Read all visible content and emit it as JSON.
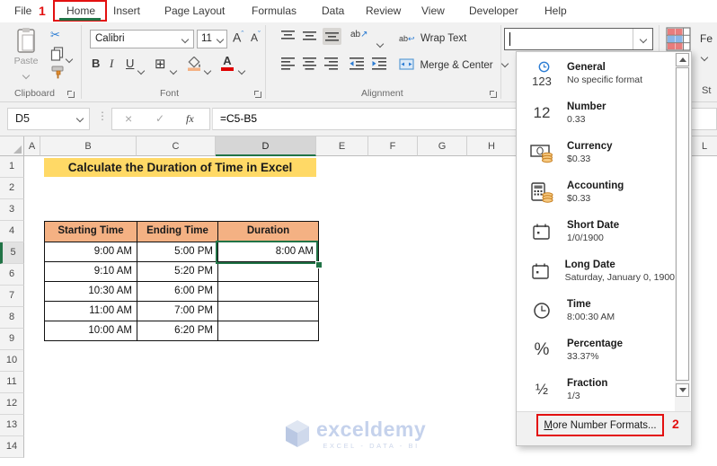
{
  "annotations": {
    "step1": "1",
    "step2": "2"
  },
  "tabs": {
    "items": [
      "File",
      "Home",
      "Insert",
      "Page Layout",
      "Formulas",
      "Data",
      "Review",
      "View",
      "Developer",
      "Help"
    ],
    "active": "Home"
  },
  "ribbon": {
    "clipboard": {
      "group_label": "Clipboard",
      "paste_label": "Paste"
    },
    "font": {
      "group_label": "Font",
      "font_name": "Calibri",
      "font_size": "11",
      "bold": "B",
      "italic": "I",
      "underline": "U",
      "grow": "A",
      "shrink": "A",
      "color_letter": "A"
    },
    "alignment": {
      "group_label": "Alignment",
      "wrap_text": "Wrap Text",
      "merge_center": "Merge & Center",
      "orientation_glyph": "ab"
    },
    "styles_fragment": {
      "fe": "Fe",
      "st": "St"
    }
  },
  "formula_bar": {
    "name_box": "D5",
    "cancel_glyph": "×",
    "enter_glyph": "✓",
    "fx_label": "fx",
    "formula": "=C5-B5"
  },
  "sheet": {
    "columns": [
      "A",
      "B",
      "C",
      "D",
      "E",
      "F",
      "G",
      "H"
    ],
    "partial_column": "L",
    "rows": [
      "1",
      "2",
      "3",
      "4",
      "5",
      "6",
      "7",
      "8",
      "9",
      "10",
      "11",
      "12",
      "13",
      "14"
    ],
    "selected_cell": "D5",
    "title": "Calculate the Duration of Time in Excel",
    "table": {
      "headers": [
        "Starting Time",
        "Ending Time",
        "Duration"
      ],
      "rows": [
        [
          "9:00 AM",
          "5:00 PM",
          "8:00 AM"
        ],
        [
          "9:10 AM",
          "5:20 PM",
          ""
        ],
        [
          "10:30 AM",
          "6:00 PM",
          ""
        ],
        [
          "11:00 AM",
          "7:00 PM",
          ""
        ],
        [
          "10:00 AM",
          "6:20 PM",
          ""
        ]
      ]
    },
    "watermark": {
      "brand": "exceldemy",
      "tagline": "EXCEL - DATA - BI"
    }
  },
  "format_dropdown": {
    "items": [
      {
        "name": "General",
        "example": "No specific format",
        "glyph": "123"
      },
      {
        "name": "Number",
        "example": "0.33",
        "glyph": "12"
      },
      {
        "name": "Currency",
        "example": "$0.33"
      },
      {
        "name": "Accounting",
        "example": "$0.33"
      },
      {
        "name": "Short Date",
        "example": "1/0/1900"
      },
      {
        "name": "Long Date",
        "example": "Saturday, January 0, 1900"
      },
      {
        "name": "Time",
        "example": "8:00:30 AM"
      },
      {
        "name": "Percentage",
        "example": "33.37%",
        "glyph": "%"
      },
      {
        "name": "Fraction",
        "example": "1/3",
        "glyph": "½"
      }
    ],
    "footer": "More Number Formats..."
  },
  "colors": {
    "excel_green": "#217346",
    "annotation_red": "#e31010",
    "title_bg": "#FFD966",
    "table_header_bg": "#F4B183",
    "coin_orange": "#E8A33D",
    "icon_blue": "#2B7CD3"
  }
}
